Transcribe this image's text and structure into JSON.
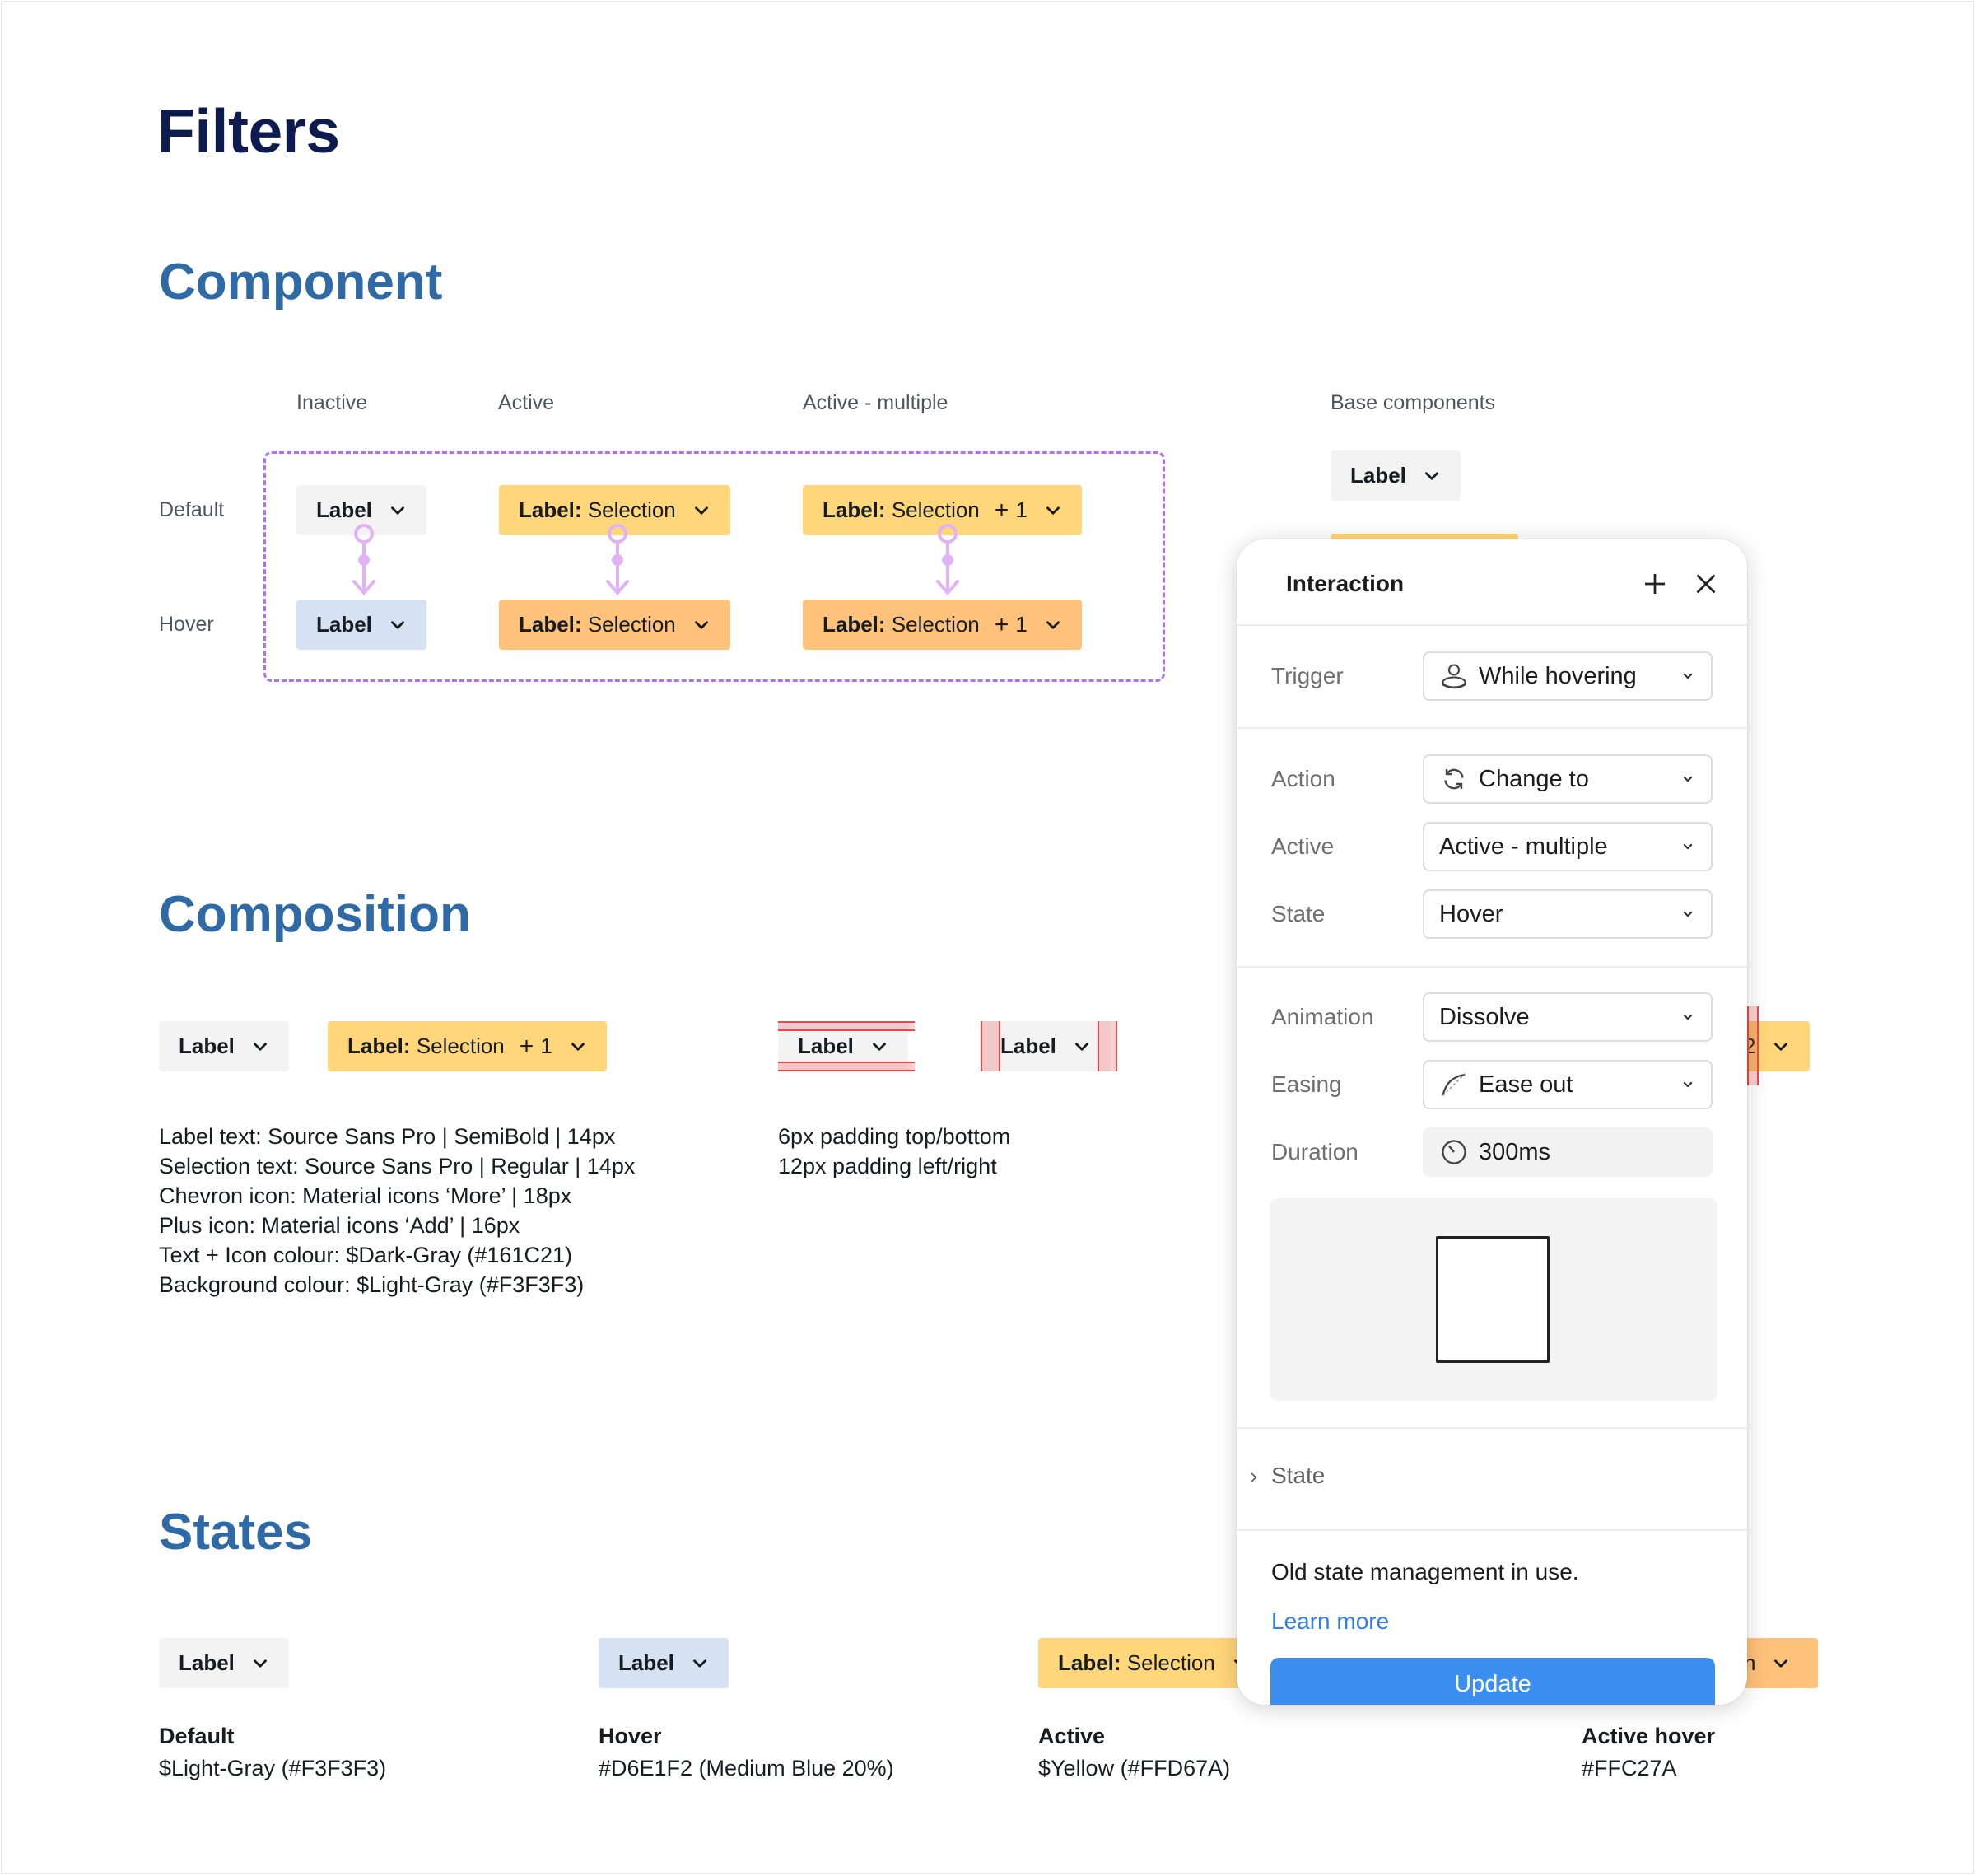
{
  "page": {
    "title": "Filters"
  },
  "sections": {
    "component": "Component",
    "composition": "Composition",
    "states": "States"
  },
  "component": {
    "columns": [
      "Inactive",
      "Active",
      "Active - multiple"
    ],
    "rows": [
      "Default",
      "Hover"
    ],
    "base_heading": "Base components"
  },
  "chip": {
    "label": "Label",
    "label_prefix": "Label:",
    "selection": "Selection",
    "plus": "+",
    "count": "1"
  },
  "composition": {
    "specs": [
      "Label text: Source Sans Pro  |  SemiBold  |  14px",
      "Selection text: Source Sans Pro  |  Regular  |  14px",
      "Chevron icon: Material icons ‘More’  |  18px",
      "Plus icon: Material icons ‘Add’  |  16px",
      "Text + Icon colour: $Dark-Gray (#161C21)",
      "Background colour: $Light-Gray (#F3F3F3)"
    ],
    "padding_notes": [
      "6px padding top/bottom",
      "12px padding left/right"
    ],
    "partial_chip_text": "2"
  },
  "states": [
    {
      "name": "Default",
      "value": "$Light-Gray (#F3F3F3)"
    },
    {
      "name": "Hover",
      "value": "#D6E1F2 (Medium Blue 20%)"
    },
    {
      "name": "Active",
      "value": "$Yellow (#FFD67A)"
    },
    {
      "name": "Active hover",
      "value": "#FFC27A"
    }
  ],
  "states_partial_text": "n",
  "interaction": {
    "title": "Interaction",
    "trigger_label": "Trigger",
    "trigger_value": "While hovering",
    "action_label": "Action",
    "action_value": "Change to",
    "active_label": "Active",
    "active_value": "Active - multiple",
    "state_label": "State",
    "state_value": "Hover",
    "animation_label": "Animation",
    "animation_value": "Dissolve",
    "easing_label": "Easing",
    "easing_value": "Ease out",
    "duration_label": "Duration",
    "duration_value": "300ms",
    "state_section": "State",
    "notice": "Old state management in use.",
    "learn_more": "Learn more",
    "update": "Update"
  },
  "colors": {
    "light_gray": "#F3F3F3",
    "medium_blue_20": "#D6E1F2",
    "yellow": "#FFD67A",
    "active_hover": "#FFC27A",
    "dark_gray": "#161C21",
    "accent_blue": "#3b8ef0",
    "dashed_purple": "#b46ef2"
  },
  "icons": [
    "chevron-down-icon",
    "plus-icon",
    "close-icon",
    "hover-hand-icon",
    "refresh-icon",
    "easing-curve-icon",
    "timer-icon",
    "chevron-right-icon"
  ]
}
